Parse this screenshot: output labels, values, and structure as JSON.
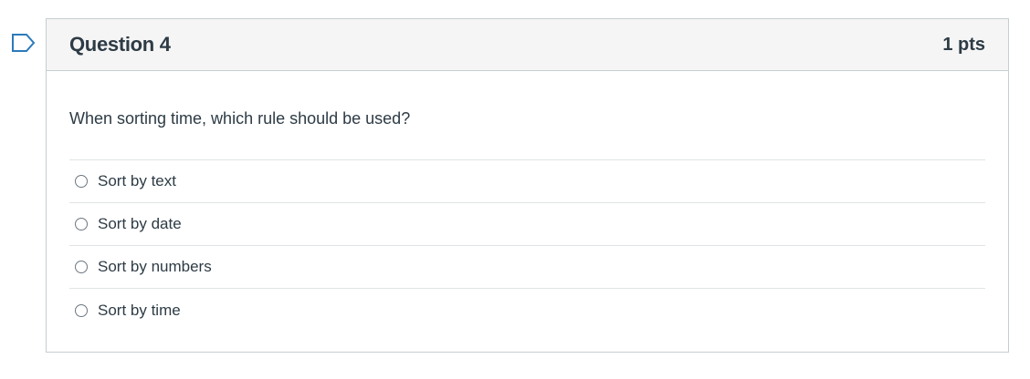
{
  "question": {
    "title": "Question 4",
    "points": "1 pts",
    "text": "When sorting time, which rule should be used?",
    "answers": [
      {
        "label": "Sort by text"
      },
      {
        "label": "Sort by date"
      },
      {
        "label": "Sort by numbers"
      },
      {
        "label": "Sort by time"
      }
    ]
  },
  "icons": {
    "flag": "flag-icon",
    "radio": "radio-unchecked-icon"
  },
  "colors": {
    "flag": "#2b7abc",
    "header_bg": "#f5f5f5",
    "border": "#c7cdd1",
    "text": "#2d3b45"
  }
}
